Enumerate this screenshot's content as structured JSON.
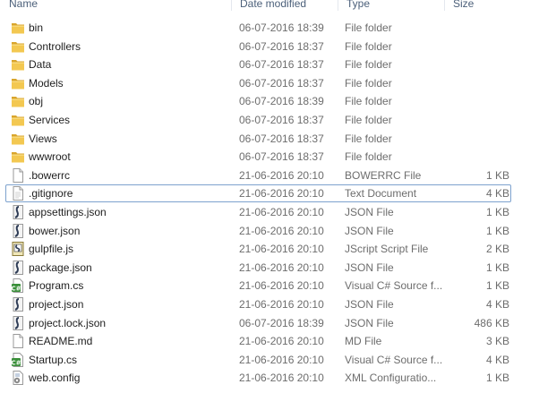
{
  "columns": {
    "name": "Name",
    "date": "Date modified",
    "type": "Type",
    "size": "Size"
  },
  "rows": [
    {
      "name": "bin",
      "date": "06-07-2016 18:39",
      "type": "File folder",
      "size": "",
      "icon": "folder-icon"
    },
    {
      "name": "Controllers",
      "date": "06-07-2016 18:37",
      "type": "File folder",
      "size": "",
      "icon": "folder-icon"
    },
    {
      "name": "Data",
      "date": "06-07-2016 18:37",
      "type": "File folder",
      "size": "",
      "icon": "folder-icon"
    },
    {
      "name": "Models",
      "date": "06-07-2016 18:37",
      "type": "File folder",
      "size": "",
      "icon": "folder-icon"
    },
    {
      "name": "obj",
      "date": "06-07-2016 18:39",
      "type": "File folder",
      "size": "",
      "icon": "folder-icon"
    },
    {
      "name": "Services",
      "date": "06-07-2016 18:37",
      "type": "File folder",
      "size": "",
      "icon": "folder-icon"
    },
    {
      "name": "Views",
      "date": "06-07-2016 18:37",
      "type": "File folder",
      "size": "",
      "icon": "folder-icon"
    },
    {
      "name": "wwwroot",
      "date": "06-07-2016 18:37",
      "type": "File folder",
      "size": "",
      "icon": "folder-icon"
    },
    {
      "name": ".bowerrc",
      "date": "21-06-2016 20:10",
      "type": "BOWERRC File",
      "size": "1 KB",
      "icon": "blank-file-icon"
    },
    {
      "name": ".gitignore",
      "date": "21-06-2016 20:10",
      "type": "Text Document",
      "size": "4 KB",
      "icon": "text-file-icon"
    },
    {
      "name": "appsettings.json",
      "date": "21-06-2016 20:10",
      "type": "JSON File",
      "size": "1 KB",
      "icon": "json-file-icon"
    },
    {
      "name": "bower.json",
      "date": "21-06-2016 20:10",
      "type": "JSON File",
      "size": "1 KB",
      "icon": "json-file-icon"
    },
    {
      "name": "gulpfile.js",
      "date": "21-06-2016 20:10",
      "type": "JScript Script File",
      "size": "2 KB",
      "icon": "script-file-icon"
    },
    {
      "name": "package.json",
      "date": "21-06-2016 20:10",
      "type": "JSON File",
      "size": "1 KB",
      "icon": "json-file-icon"
    },
    {
      "name": "Program.cs",
      "date": "21-06-2016 20:10",
      "type": "Visual C# Source f...",
      "size": "1 KB",
      "icon": "csharp-file-icon"
    },
    {
      "name": "project.json",
      "date": "21-06-2016 20:10",
      "type": "JSON File",
      "size": "4 KB",
      "icon": "json-file-icon"
    },
    {
      "name": "project.lock.json",
      "date": "06-07-2016 18:39",
      "type": "JSON File",
      "size": "486 KB",
      "icon": "json-file-icon"
    },
    {
      "name": "README.md",
      "date": "21-06-2016 20:10",
      "type": "MD File",
      "size": "3 KB",
      "icon": "blank-file-icon"
    },
    {
      "name": "Startup.cs",
      "date": "21-06-2016 20:10",
      "type": "Visual C# Source f...",
      "size": "4 KB",
      "icon": "csharp-file-icon"
    },
    {
      "name": "web.config",
      "date": "21-06-2016 20:10",
      "type": "XML Configuratio...",
      "size": "1 KB",
      "icon": "config-file-icon"
    }
  ],
  "focused_row": 9,
  "colors": {
    "folder": "#e8b83a",
    "focus_border": "#7da2ce",
    "header_text": "#4c607a",
    "secondary_text": "#6d6d6d"
  }
}
